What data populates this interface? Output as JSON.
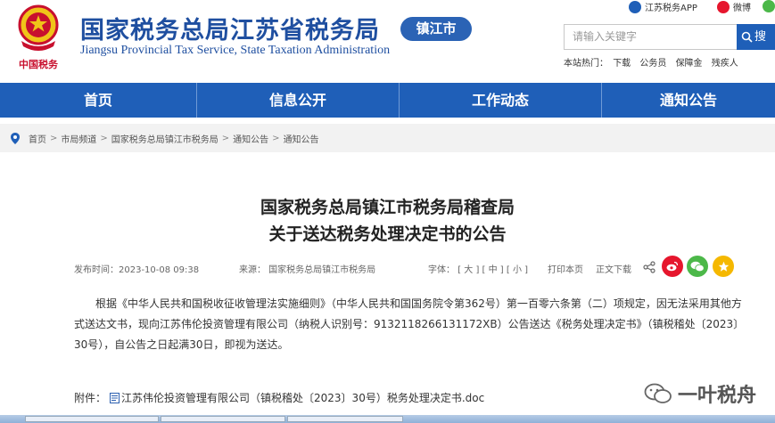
{
  "header": {
    "emblem_text": "中国税务",
    "site_title": "国家税务总局江苏省税务局",
    "site_subtitle": "Jiangsu Provincial Tax Service, State Taxation Administration",
    "city_badge": "镇江市",
    "top_links": [
      {
        "label": "江苏税务APP",
        "icon": "app-icon"
      },
      {
        "label": "微博",
        "icon": "weibo-icon"
      }
    ],
    "search_placeholder": "请输入关键字",
    "search_button": "搜",
    "quick_label": "本站热门：",
    "quick_links": [
      "下载",
      "公务员",
      "保障金",
      "残疾人"
    ]
  },
  "nav": {
    "items": [
      "首页",
      "信息公开",
      "工作动态",
      "通知公告"
    ]
  },
  "breadcrumb": [
    "首页",
    "市局频道",
    "国家税务总局镇江市税务局",
    "通知公告",
    "通知公告"
  ],
  "article": {
    "title_line1": "国家税务总局镇江市税务局稽查局",
    "title_line2": "关于送达税务处理决定书的公告",
    "publish_time": "发布时间：2023-10-08 09:38",
    "source": "来源：  国家税务总局镇江市税务局",
    "font_label": "字体：",
    "font_large": "[ 大 ]",
    "font_medium": "[ 中 ]",
    "font_small": "[ 小 ]",
    "print": "打印本页",
    "download": "正文下载",
    "body": "根据《中华人民共和国税收征收管理法实施细则》（中华人民共和国国务院令第362号）第一百零六条第（二）项规定，因无法采用其他方式送达文书，现向江苏伟伦投资管理有限公司（纳税人识别号：9132118266131172XB）公告送达《税务处理决定书》（镇税稽处〔2023〕30号），自公告之日起满30日，即视为送达。",
    "attachment_label": "附件：",
    "attachment_file": "江苏伟伦投资管理有限公司（镇税稽处〔2023〕30号）税务处理决定书.doc"
  },
  "watermark": "一叶税舟",
  "colors": {
    "brand_blue": "#1f5fb8",
    "title_blue": "#1f4fa0",
    "weibo_red": "#e6162d",
    "wechat_green": "#4cb849",
    "favorite_yellow": "#f5b800"
  }
}
